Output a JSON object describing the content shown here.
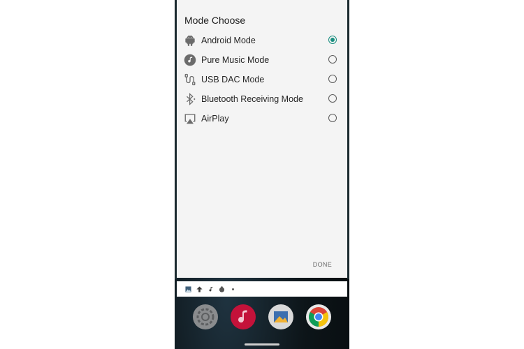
{
  "dialog": {
    "title": "Mode Choose",
    "options": [
      {
        "label": "Android Mode",
        "icon": "android-icon",
        "selected": true
      },
      {
        "label": "Pure Music Mode",
        "icon": "music-note-icon",
        "selected": false
      },
      {
        "label": "USB DAC Mode",
        "icon": "usb-cable-icon",
        "selected": false
      },
      {
        "label": "Bluetooth Receiving Mode",
        "icon": "bluetooth-icon",
        "selected": false
      },
      {
        "label": "AirPlay",
        "icon": "airplay-icon",
        "selected": false
      }
    ],
    "done_label": "DONE"
  },
  "status_bar": {
    "icons": [
      "image-icon",
      "upload-arrow-icon",
      "music-note-icon",
      "bug-icon",
      "dot-icon"
    ]
  },
  "dock": {
    "apps": [
      "settings-app-icon",
      "music-app-icon",
      "gallery-app-icon",
      "chrome-app-icon"
    ]
  },
  "colors": {
    "accent": "#1a8f80",
    "dialog_bg": "#f4f4f4",
    "text": "#262626",
    "icon": "#6b6b6b"
  }
}
